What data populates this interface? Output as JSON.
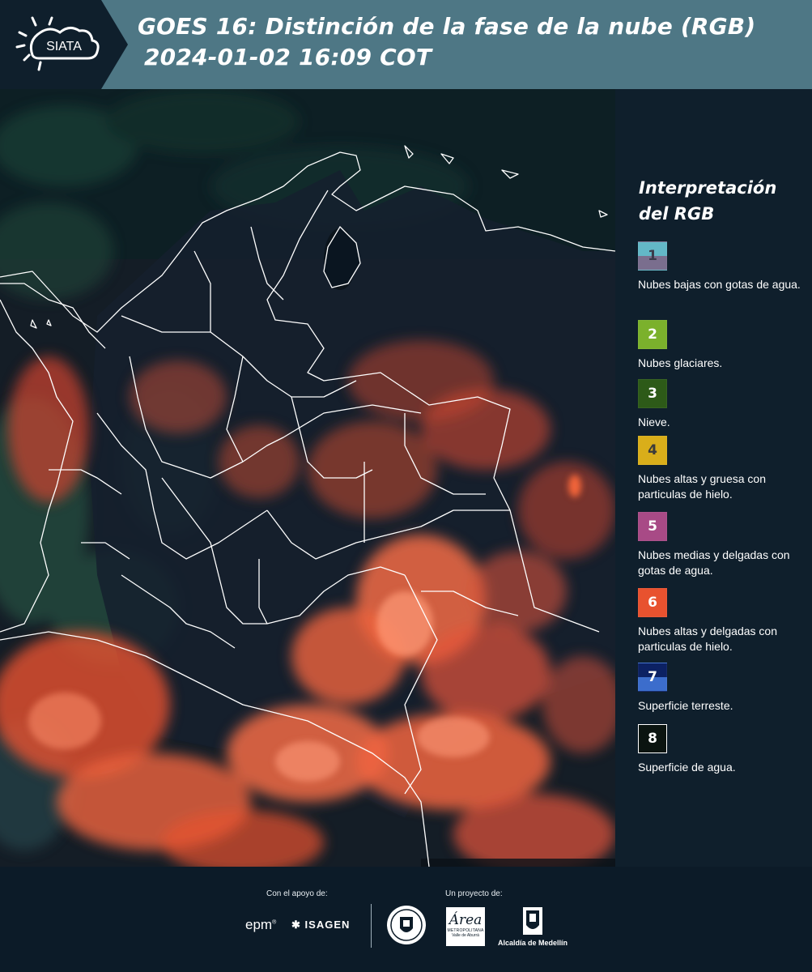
{
  "header": {
    "logo_text": "SIATA",
    "title_line1": "GOES 16: Distinción de la fase de la nube (RGB)",
    "title_line2": "2024-01-02 16:09 COT",
    "background_color": "#4e7785"
  },
  "map": {
    "description_icon": "satellite-rgb-map",
    "cloud_color": "#f0593a",
    "land_color": "#1a2a3a",
    "border_color": "#ffffff"
  },
  "legend": {
    "title": "Interpretación del RGB",
    "items": [
      {
        "number": "1",
        "label": "Nubes bajas con gotas de agua.",
        "color": "#63b7c7",
        "color2": "#7a6e8e"
      },
      {
        "number": "2",
        "label": "Nubes glaciares.",
        "color": "#7bb12c"
      },
      {
        "number": "3",
        "label": "Nieve.",
        "color": "#2d5a18"
      },
      {
        "number": "4",
        "label": "Nubes altas y gruesa con particulas de hielo.",
        "color": "#d9ae1a"
      },
      {
        "number": "5",
        "label": "Nubes medias y delgadas con gotas de agua.",
        "color": "#a84a86"
      },
      {
        "number": "6",
        "label": "Nubes altas y delgadas con particulas de hielo.",
        "color": "#e8522f"
      },
      {
        "number": "7",
        "label": "Superficie terreste.",
        "color": "#0c2163",
        "color2": "#3c6dcc"
      },
      {
        "number": "8",
        "label": "Superficie de agua.",
        "color": "#0b1410"
      }
    ]
  },
  "footer": {
    "support_label": "Con el apoyo de:",
    "project_label": "Un proyecto de:",
    "logos": {
      "epm": "epm",
      "isagen": "ISAGEN",
      "area_metro": "Área",
      "area_sub": "METROPOLITANA",
      "area_sub2": "Valle de Aburrá",
      "alcaldia": "Alcaldía de Medellín"
    }
  }
}
